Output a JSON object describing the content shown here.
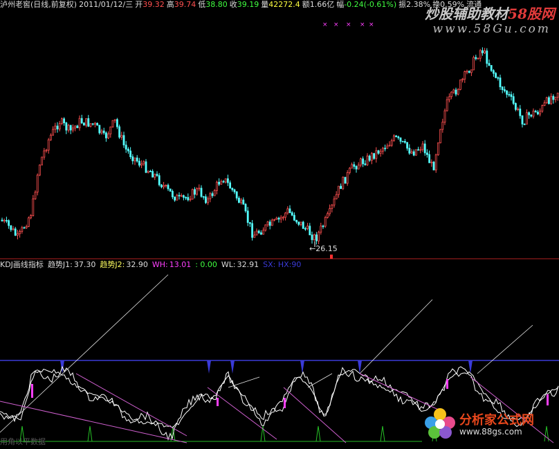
{
  "header": {
    "title": "泸州老窖(日线,前复权)",
    "date": "2011/01/12/三",
    "open_label": "开",
    "open": "39.32",
    "high_label": "高",
    "high": "39.74",
    "low_label": "低",
    "low": "38.80",
    "close_label": "收",
    "close": "39.19",
    "vol_label": "量",
    "vol": "42272.4",
    "amt_label": "额",
    "amt": "1.66亿",
    "chg_label": "幅",
    "chg": "-0.24(-0.61%)",
    "amp_label": "振",
    "amp": "2.38%",
    "turn_label": "换",
    "turn": "0.59%",
    "float_label": "流通"
  },
  "price_annotation": "←26.15",
  "indicator": {
    "name": "KDJ画线指标",
    "j1_label": "趋势J1:",
    "j1": "37.30",
    "j2_label": "趋势J2:",
    "j2": "32.90",
    "wh_label": "WH:",
    "wh": "13.01",
    "zero": ": 0.00",
    "wl_label": "WL:",
    "wl": "32.91",
    "extra": "SX: HX:90"
  },
  "watermarks": {
    "top_prefix": "炒股辅助教材",
    "top_brand": "58股网",
    "top_url": "www.58Gu.com",
    "bottom_brand": "分析家公式网",
    "bottom_url": "www.88gs.com"
  },
  "bottom_text": "用角以平数据",
  "colors": {
    "up": "#ff5050",
    "down": "#54ffff",
    "bg": "#000000",
    "kline": "#ffffff",
    "dline": "#ffffff",
    "level_line": "#3a3ad8",
    "spike": "#26c026",
    "magenta": "#ff40ff",
    "trend": "#d060d0"
  }
}
